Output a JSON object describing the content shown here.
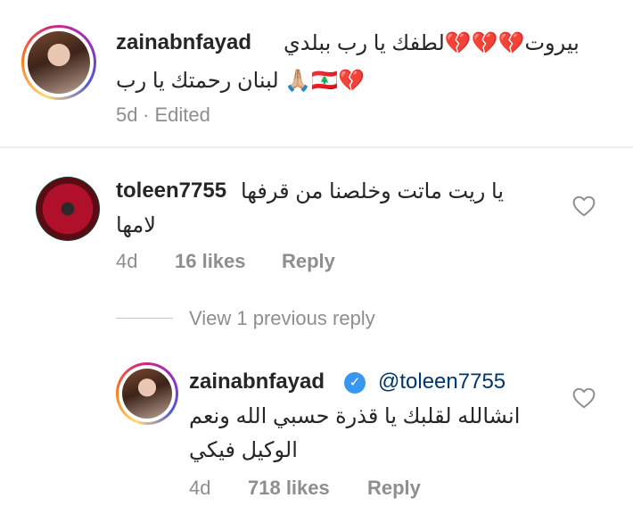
{
  "post": {
    "username": "zainabnfayad",
    "caption_line1": "بيروت💔💔💔لطفك يا رب ببلدي",
    "caption_line2": "💔🇱🇧🙏🏼 لبنان رحمتك يا رب",
    "time": "5d",
    "edited": "· Edited"
  },
  "comments": [
    {
      "username": "toleen7755",
      "text_line1": "يا ريت ماتت وخلصنا من قرفها",
      "text_line2": "لامها",
      "time": "4d",
      "likes": "16 likes",
      "reply_label": "Reply"
    }
  ],
  "view_replies": "View 1 previous reply",
  "reply": {
    "username": "zainabnfayad",
    "mention": "@toleen7755",
    "text_line1": "انشالله لقلبك يا قذرة حسبي الله ونعم",
    "text_line2": "الوكيل فيكي",
    "time": "4d",
    "likes": "718 likes",
    "reply_label": "Reply"
  },
  "icons": {
    "heart": "heart-outline-icon",
    "verified": "verified-badge-icon"
  },
  "colors": {
    "meta": "#8e8e8e",
    "verified": "#3897f0",
    "mention": "#00376b"
  }
}
